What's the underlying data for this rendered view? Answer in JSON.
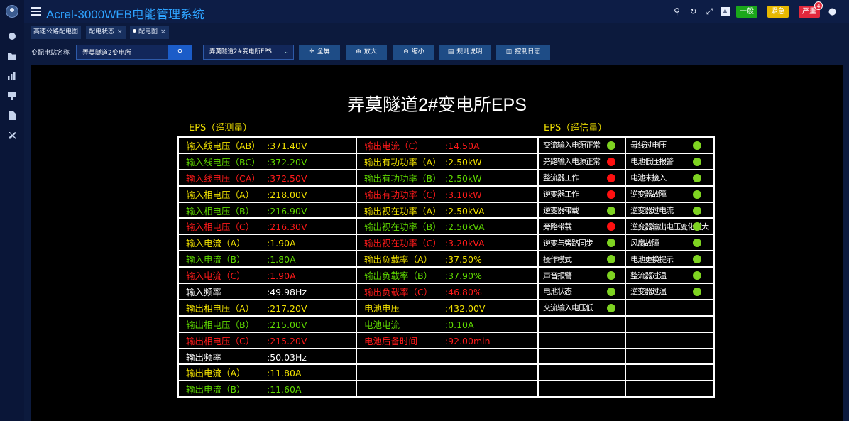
{
  "app": {
    "title": "Acrel-3000WEB电能管理系统"
  },
  "header": {
    "badges": [
      {
        "label": "一般",
        "color": "#1aa81a"
      },
      {
        "label": "紧急",
        "color": "#e8b800"
      },
      {
        "label": "严重",
        "color": "#e2283c"
      }
    ],
    "alarm_count": "4",
    "icons": [
      "search-icon",
      "refresh-icon",
      "fullscreen-icon",
      "screen-icon",
      "user-icon"
    ]
  },
  "sidebar": {
    "icons": [
      "dashboard-icon",
      "folder-icon",
      "chart-icon",
      "billboard-icon",
      "document-icon",
      "tools-icon"
    ]
  },
  "tabs": [
    {
      "label": "高速公路配电图",
      "closable": false
    },
    {
      "label": "配电状态",
      "closable": true
    },
    {
      "label": "配电图",
      "closable": true,
      "active": true
    }
  ],
  "toolbar": {
    "station_label": "变配电站名称",
    "station_value": "弄莫隧道2变电所",
    "diagram_selected": "弄莫隧道2#变电所EPS",
    "buttons": [
      {
        "label": "全屏",
        "icon": "✛"
      },
      {
        "label": "放大",
        "icon": "⊕"
      },
      {
        "label": "缩小",
        "icon": "⊖"
      },
      {
        "label": "规则说明",
        "icon": "▤"
      },
      {
        "label": "控制日志",
        "icon": "◫"
      }
    ]
  },
  "diagram": {
    "title": "弄莫隧道2#变电所EPS",
    "telemetry_title": "EPS（遥测量）",
    "signal_title": "EPS（遥信量）",
    "telemetry_col1": [
      {
        "label": "输入线电压（AB）",
        "value": ":371.40V",
        "color": "y"
      },
      {
        "label": "输入线电压（BC）",
        "value": ":372.20V",
        "color": "g"
      },
      {
        "label": "输入线电压（CA）",
        "value": ":372.50V",
        "color": "r"
      },
      {
        "label": "输入相电压（A）",
        "value": ":218.00V",
        "color": "y"
      },
      {
        "label": "输入相电压（B）",
        "value": ":216.90V",
        "color": "g"
      },
      {
        "label": "输入相电压（C）",
        "value": ":216.30V",
        "color": "r"
      },
      {
        "label": "输入电流（A）",
        "value": ":1.90A",
        "color": "y"
      },
      {
        "label": "输入电流（B）",
        "value": ":1.80A",
        "color": "g"
      },
      {
        "label": "输入电流（C）",
        "value": ":1.90A",
        "color": "r"
      },
      {
        "label": "输入频率",
        "value": ":49.98Hz",
        "color": "w"
      },
      {
        "label": "输出相电压（A）",
        "value": ":217.20V",
        "color": "y"
      },
      {
        "label": "输出相电压（B）",
        "value": ":215.00V",
        "color": "g"
      },
      {
        "label": "输出相电压（C）",
        "value": ":215.20V",
        "color": "r"
      },
      {
        "label": "输出频率",
        "value": ":50.03Hz",
        "color": "w"
      },
      {
        "label": "输出电流（A）",
        "value": ":11.80A",
        "color": "y"
      },
      {
        "label": "输出电流（B）",
        "value": ":11.60A",
        "color": "g"
      }
    ],
    "telemetry_col2": [
      {
        "label": "输出电流（C）",
        "value": ":14.50A",
        "color": "r"
      },
      {
        "label": "输出有功功率（A）",
        "value": ":2.50kW",
        "color": "y"
      },
      {
        "label": "输出有功功率（B）",
        "value": ":2.50kW",
        "color": "g"
      },
      {
        "label": "输出有功功率（C）",
        "value": ":3.10kW",
        "color": "r"
      },
      {
        "label": "输出视在功率（A）",
        "value": ":2.50kVA",
        "color": "y"
      },
      {
        "label": "输出视在功率（B）",
        "value": ":2.50kVA",
        "color": "g"
      },
      {
        "label": "输出视在功率（C）",
        "value": ":3.20kVA",
        "color": "r"
      },
      {
        "label": "输出负载率（A）",
        "value": ":37.50%",
        "color": "y"
      },
      {
        "label": "输出负载率（B）",
        "value": ":37.90%",
        "color": "g"
      },
      {
        "label": "输出负载率（C）",
        "value": ":46.80%",
        "color": "r"
      },
      {
        "label": "电池电压",
        "value": ":432.00V",
        "color": "y"
      },
      {
        "label": "电池电流",
        "value": ":0.10A",
        "color": "g"
      },
      {
        "label": "电池后备时间",
        "value": ":92.00min",
        "color": "r"
      },
      {
        "label": "",
        "value": "",
        "color": "w"
      },
      {
        "label": "",
        "value": "",
        "color": "w"
      },
      {
        "label": "",
        "value": "",
        "color": "w"
      }
    ],
    "signal_col1": [
      {
        "label": "交流输入电源正常",
        "status": "green"
      },
      {
        "label": "旁路输入电源正常",
        "status": "red"
      },
      {
        "label": "整流器工作",
        "status": "red"
      },
      {
        "label": "逆变器工作",
        "status": "red"
      },
      {
        "label": "逆变器带载",
        "status": "green"
      },
      {
        "label": "旁路带载",
        "status": "red"
      },
      {
        "label": "逆变与旁路同步",
        "status": "green"
      },
      {
        "label": "操作模式",
        "status": "green"
      },
      {
        "label": "声音报警",
        "status": "green"
      },
      {
        "label": "电池状态",
        "status": "green"
      },
      {
        "label": "交流输入电压低",
        "status": "green"
      },
      {
        "label": "",
        "status": ""
      },
      {
        "label": "",
        "status": ""
      },
      {
        "label": "",
        "status": ""
      },
      {
        "label": "",
        "status": ""
      },
      {
        "label": "",
        "status": ""
      }
    ],
    "signal_col2": [
      {
        "label": "母线过电压",
        "status": "green"
      },
      {
        "label": "电池低压报警",
        "status": "green"
      },
      {
        "label": "电池未接入",
        "status": "green"
      },
      {
        "label": "逆变器故障",
        "status": "green"
      },
      {
        "label": "逆变器过电流",
        "status": "green"
      },
      {
        "label": "逆变器输出电压变化过大",
        "status": "green"
      },
      {
        "label": "风扇故障",
        "status": "green"
      },
      {
        "label": "电池更换提示",
        "status": "green"
      },
      {
        "label": "整流器过温",
        "status": "green"
      },
      {
        "label": "逆变器过温",
        "status": "green"
      },
      {
        "label": "",
        "status": ""
      },
      {
        "label": "",
        "status": ""
      },
      {
        "label": "",
        "status": ""
      },
      {
        "label": "",
        "status": ""
      },
      {
        "label": "",
        "status": ""
      },
      {
        "label": "",
        "status": ""
      }
    ]
  }
}
